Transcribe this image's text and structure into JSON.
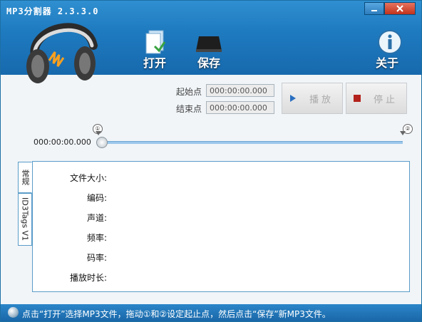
{
  "window": {
    "title": "MP3分割器 2.3.3.0"
  },
  "toolbar": {
    "open_label": "打开",
    "save_label": "保存",
    "about_label": "关于"
  },
  "range": {
    "start_label": "起始点",
    "start_value": "000:00:00.000",
    "end_label": "结束点",
    "end_value": "000:00:00.000"
  },
  "player": {
    "play_label": "播放",
    "stop_label": "停止"
  },
  "timeline": {
    "current_time": "000:00:00.000",
    "marker_start": "①",
    "marker_end": "②"
  },
  "tabs": [
    {
      "label": "常规"
    },
    {
      "label": "ID3Tags V1"
    }
  ],
  "info": {
    "fields": [
      "文件大小:",
      "编码:",
      "声道:",
      "频率:",
      "码率:",
      "播放时长:"
    ]
  },
  "status": {
    "message": "点击“打开”选择MP3文件，拖动①和②设定起止点，然后点击“保存”新MP3文件。"
  },
  "colors": {
    "header": "#1f7bc0",
    "status_bar": "#1a67a8",
    "panel_border": "#5a9cc8"
  }
}
